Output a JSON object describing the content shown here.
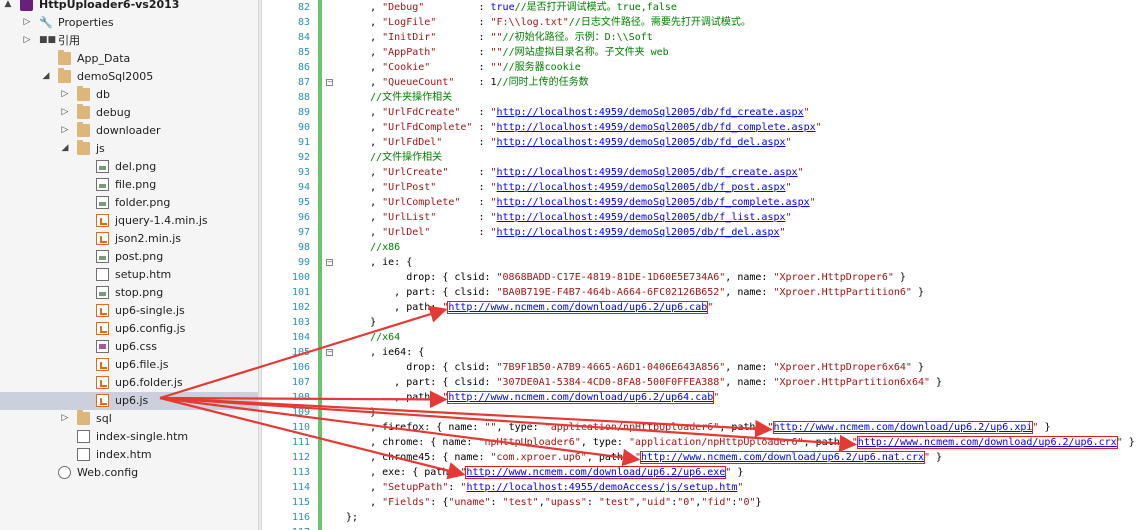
{
  "explorer": {
    "items": [
      {
        "label": "HttpUploader6-vs2013",
        "icon": "project-icon",
        "expander": "▲",
        "bold": true
      },
      {
        "label": "Properties",
        "icon": "wrench-icon",
        "expander": "▷"
      },
      {
        "label": "引用",
        "icon": "references-icon",
        "expander": "▷"
      },
      {
        "label": "App_Data",
        "icon": "folder-icon",
        "expander": ""
      },
      {
        "label": "demoSql2005",
        "icon": "folder-icon",
        "expander": "◢"
      },
      {
        "label": "db",
        "icon": "folder-icon",
        "expander": "▷"
      },
      {
        "label": "debug",
        "icon": "folder-icon",
        "expander": "▷"
      },
      {
        "label": "downloader",
        "icon": "folder-icon",
        "expander": "▷"
      },
      {
        "label": "js",
        "icon": "folder-icon",
        "expander": "◢"
      },
      {
        "label": "del.png",
        "icon": "image-file-icon",
        "expander": ""
      },
      {
        "label": "file.png",
        "icon": "image-file-icon",
        "expander": ""
      },
      {
        "label": "folder.png",
        "icon": "image-file-icon",
        "expander": ""
      },
      {
        "label": "jquery-1.4.min.js",
        "icon": "js-file-icon",
        "expander": ""
      },
      {
        "label": "json2.min.js",
        "icon": "js-file-icon",
        "expander": ""
      },
      {
        "label": "post.png",
        "icon": "image-file-icon",
        "expander": ""
      },
      {
        "label": "setup.htm",
        "icon": "html-file-icon",
        "expander": ""
      },
      {
        "label": "stop.png",
        "icon": "image-file-icon",
        "expander": ""
      },
      {
        "label": "up6-single.js",
        "icon": "js-file-icon",
        "expander": ""
      },
      {
        "label": "up6.config.js",
        "icon": "js-file-icon",
        "expander": ""
      },
      {
        "label": "up6.css",
        "icon": "css-file-icon",
        "expander": ""
      },
      {
        "label": "up6.file.js",
        "icon": "js-file-icon",
        "expander": ""
      },
      {
        "label": "up6.folder.js",
        "icon": "js-file-icon",
        "expander": ""
      },
      {
        "label": "up6.js",
        "icon": "js-file-icon",
        "expander": "",
        "selected": true
      },
      {
        "label": "sql",
        "icon": "folder-icon",
        "expander": "▷"
      },
      {
        "label": "index-single.htm",
        "icon": "html-file-icon",
        "expander": ""
      },
      {
        "label": "index.htm",
        "icon": "html-file-icon",
        "expander": ""
      },
      {
        "label": "Web.config",
        "icon": "config-file-icon",
        "expander": ""
      }
    ]
  },
  "editor": {
    "lines": [
      {
        "n": "82",
        "code": "    , \"Debug\"         : true//是否打开调试模式。true,false"
      },
      {
        "n": "83",
        "code": "    , \"LogFile\"       : \"F:\\\\log.txt\"//日志文件路径。需要先打开调试模式。"
      },
      {
        "n": "84",
        "code": "    , \"InitDir\"       : \"\"//初始化路径。示例：D:\\\\Soft"
      },
      {
        "n": "85",
        "code": "    , \"AppPath\"       : \"\"//网站虚拟目录名称。子文件夹 web"
      },
      {
        "n": "86",
        "code": "    , \"Cookie\"        : \"\"//服务器cookie"
      },
      {
        "n": "87",
        "code": "    , \"QueueCount\"    : 1//同时上传的任务数"
      },
      {
        "n": "88",
        "code": "    //文件夹操作相关"
      },
      {
        "n": "89",
        "code": "    , \"UrlFdCreate\"   : \"http://localhost:4959/demoSql2005/db/fd_create.aspx\""
      },
      {
        "n": "90",
        "code": "    , \"UrlFdComplete\" : \"http://localhost:4959/demoSql2005/db/fd_complete.aspx\""
      },
      {
        "n": "91",
        "code": "    , \"UrlFdDel\"      : \"http://localhost:4959/demoSql2005/db/fd_del.aspx\""
      },
      {
        "n": "92",
        "code": "    //文件操作相关"
      },
      {
        "n": "93",
        "code": "    , \"UrlCreate\"     : \"http://localhost:4959/demoSql2005/db/f_create.aspx\""
      },
      {
        "n": "94",
        "code": "    , \"UrlPost\"       : \"http://localhost:4959/demoSql2005/db/f_post.aspx\""
      },
      {
        "n": "95",
        "code": "    , \"UrlComplete\"   : \"http://localhost:4959/demoSql2005/db/f_complete.aspx\""
      },
      {
        "n": "96",
        "code": "    , \"UrlList\"       : \"http://localhost:4959/demoSql2005/db/f_list.aspx\""
      },
      {
        "n": "97",
        "code": "    , \"UrlDel\"        : \"http://localhost:4959/demoSql2005/db/f_del.aspx\""
      },
      {
        "n": "98",
        "code": "    //x86"
      },
      {
        "n": "99",
        "code": "    , ie: {"
      },
      {
        "n": "100",
        "code": "          drop: { clsid: \"0868BADD-C17E-4819-81DE-1D60E5E734A6\", name: \"Xproer.HttpDroper6\" }"
      },
      {
        "n": "101",
        "code": "        , part: { clsid: \"BA0B719E-F4B7-464b-A664-6FC02126B652\", name: \"Xproer.HttpPartition6\" }"
      },
      {
        "n": "102",
        "code": "        , path: \"http://www.ncmem.com/download/up6.2/up6.cab\""
      },
      {
        "n": "103",
        "code": "    }"
      },
      {
        "n": "104",
        "code": "    //x64"
      },
      {
        "n": "105",
        "code": "    , ie64: {"
      },
      {
        "n": "106",
        "code": "          drop: { clsid: \"7B9F1B50-A7B9-4665-A6D1-0406E643A856\", name: \"Xproer.HttpDroper6x64\" }"
      },
      {
        "n": "107",
        "code": "        , part: { clsid: \"307DE0A1-5384-4CD0-8FA8-500F0FFEA388\", name: \"Xproer.HttpPartition6x64\" }"
      },
      {
        "n": "108",
        "code": "        , path: \"http://www.ncmem.com/download/up6.2/up64.cab\""
      },
      {
        "n": "109",
        "code": "    }"
      },
      {
        "n": "110",
        "code": "    , firefox: { name: \"\", type: \"application/npHttpUploader6\", path: \"http://www.ncmem.com/download/up6.2/up6.xpi\" }"
      },
      {
        "n": "111",
        "code": "    , chrome: { name: \"npHttpUploader6\", type: \"application/npHttpUploader6\", path: \"http://www.ncmem.com/download/up6.2/up6.crx\" }"
      },
      {
        "n": "112",
        "code": "    , chrome45: { name: \"com.xproer.up6\", path: \"http://www.ncmem.com/download/up6.2/up6.nat.crx\" }"
      },
      {
        "n": "113",
        "code": "    , exe: { path: \"http://www.ncmem.com/download/up6.2/up6.exe\" }"
      },
      {
        "n": "114",
        "code": "    , \"SetupPath\": \"http://localhost:4955/demoAccess/js/setup.htm\""
      },
      {
        "n": "115",
        "code": "    , \"Fields\": {\"uname\": \"test\",\"upass\": \"test\",\"uid\":\"0\",\"fid\":\"0\"}"
      },
      {
        "n": "116",
        "code": "};"
      },
      {
        "n": "117",
        "code": ""
      }
    ],
    "fold_markers": [
      "87",
      "99",
      "105"
    ],
    "boxed_urls": [
      "http://www.ncmem.com/download/up6.2/up6.cab",
      "http://www.ncmem.com/download/up6.2/up64.cab",
      "http://www.ncmem.com/download/up6.2/up6.xpi",
      "http://www.ncmem.com/download/up6.2/up6.crx",
      "http://www.ncmem.com/download/up6.2/up6.nat.crx",
      "http://www.ncmem.com/download/up6.2/up6.exe"
    ]
  },
  "colors": {
    "annotation_red": "#e53935",
    "selection": "#ccd0dc",
    "string": "#a31515",
    "keyword": "#0000ff",
    "comment": "#008000",
    "line_number": "#2b91af"
  }
}
